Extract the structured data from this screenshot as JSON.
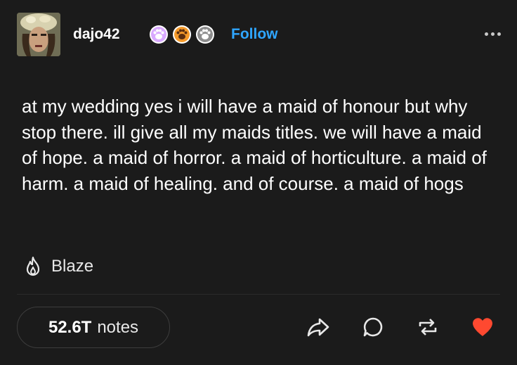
{
  "post": {
    "blog_name": "dajo42",
    "follow_label": "Follow",
    "badges": [
      "paw-badge-pink",
      "paw-badge-orange",
      "paw-badge-gray"
    ],
    "body_text": "at my wedding yes i will have a maid of honour but why stop there. ill give all my maids titles. we will have a maid of hope. a maid of horror. a maid of horticulture. a maid of harm. a maid of healing. and of course. a maid of hogs",
    "blaze_label": "Blaze",
    "notes_count": "52.6T",
    "notes_label": "notes",
    "liked": true
  },
  "colors": {
    "background": "#1b1b1b",
    "accent_follow": "#2fa6ff",
    "like": "#ff4930",
    "text": "#ffffff"
  },
  "icons": [
    "more-icon",
    "flame-icon",
    "share-icon",
    "reply-icon",
    "reblog-icon",
    "heart-icon"
  ]
}
